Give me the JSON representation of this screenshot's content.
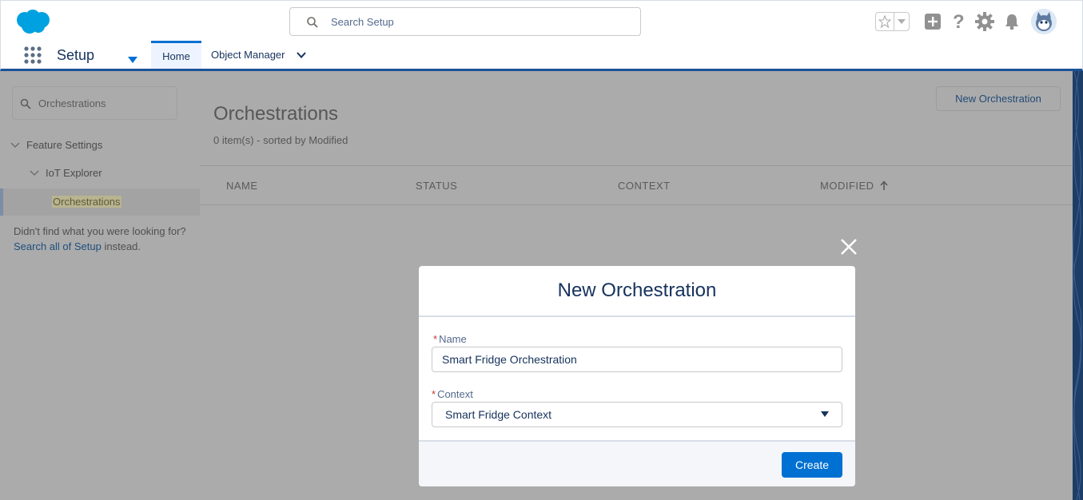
{
  "header": {
    "search_placeholder": "Search Setup",
    "brand_color": "#00a1e0"
  },
  "nav": {
    "app_title": "Setup",
    "tabs": [
      {
        "label": "Home",
        "active": true
      },
      {
        "label": "Object Manager",
        "active": false
      }
    ]
  },
  "sidebar": {
    "quick_find_value": "Orchestrations",
    "tree": [
      {
        "label": "Feature Settings"
      },
      {
        "label": "IoT Explorer"
      },
      {
        "label": "Orchestrations",
        "selected": true
      }
    ],
    "not_found_prefix": "Didn't find what you were looking for?",
    "not_found_link": "Search all of Setup",
    "not_found_suffix": "instead."
  },
  "main": {
    "new_button": "New Orchestration",
    "title": "Orchestrations",
    "subtitle": "0 item(s) - sorted by Modified",
    "columns": [
      "NAME",
      "STATUS",
      "CONTEXT",
      "MODIFIED"
    ]
  },
  "modal": {
    "title": "New Orchestration",
    "name_label": "Name",
    "name_value": "Smart Fridge Orchestration",
    "context_label": "Context",
    "context_value": "Smart Fridge Context",
    "required_marker": "*",
    "create_button": "Create",
    "accent_color": "#0070d2"
  }
}
